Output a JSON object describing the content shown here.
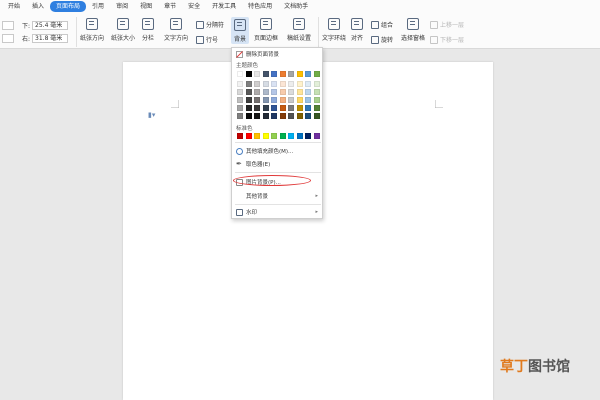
{
  "menu": {
    "tabs": [
      "开始",
      "插入",
      "页面布局",
      "引用",
      "审阅",
      "视图",
      "章节",
      "安全",
      "开发工具",
      "特色应用",
      "文档助手"
    ],
    "active_tab": "页面布局"
  },
  "ribbon": {
    "margins": {
      "top_value": "",
      "bottom_label": "下:",
      "bottom_value": "25.4 毫米",
      "left_value": "",
      "right_label": "右:",
      "right_value": "31.8 毫米"
    },
    "buttons": {
      "orientation": "纸张方向",
      "size": "纸张大小",
      "columns": "分栏",
      "text_direction": "文字方向",
      "breaks": "分隔符",
      "line_numbers": "行号",
      "background": "背景",
      "page_border": "页面边框",
      "paper_settings": "稿纸设置",
      "text_wrap": "文字环绕",
      "align": "对齐",
      "group": "组合",
      "rotate": "旋转",
      "selection_pane": "选择窗格",
      "move_up": "上移一层",
      "move_down": "下移一层"
    }
  },
  "dropdown": {
    "remove_bg": "删除页面背景",
    "theme_colors_label": "主题颜色",
    "standard_colors_label": "标准色",
    "more_fill": "其他填充颜色(M)...",
    "eyedropper": "取色器(E)",
    "picture_bg": "图片背景(P)...",
    "other_bg": "其他背景",
    "watermark": "水印",
    "theme_colors": [
      [
        "#ffffff",
        "#000000",
        "#e7e6e6",
        "#44546a",
        "#4472c4",
        "#ed7d31",
        "#a5a5a5",
        "#ffc000",
        "#5b9bd5",
        "#70ad47"
      ],
      [
        "#f2f2f2",
        "#7f7f7f",
        "#d0cece",
        "#d6dce4",
        "#d9e2f3",
        "#fbe5d5",
        "#ededed",
        "#fff2cc",
        "#deebf6",
        "#e2efd9"
      ],
      [
        "#d8d8d8",
        "#595959",
        "#aeabab",
        "#adb9ca",
        "#b4c6e7",
        "#f7cbac",
        "#dbdbdb",
        "#ffe599",
        "#bdd7ee",
        "#c5e0b3"
      ],
      [
        "#bfbfbf",
        "#3f3f3f",
        "#757070",
        "#8496b0",
        "#8eaadb",
        "#f4b183",
        "#c9c9c9",
        "#ffd965",
        "#9cc3e5",
        "#a8d08d"
      ],
      [
        "#a5a5a5",
        "#262626",
        "#3a3838",
        "#323f4f",
        "#2f5496",
        "#c55a11",
        "#7b7b7b",
        "#bf9000",
        "#2e75b5",
        "#538135"
      ],
      [
        "#7f7f7f",
        "#0c0c0c",
        "#171616",
        "#222a35",
        "#1f3864",
        "#833c0b",
        "#525252",
        "#7f6000",
        "#1e4e79",
        "#375623"
      ]
    ],
    "standard_colors": [
      "#c00000",
      "#ff0000",
      "#ffc000",
      "#ffff00",
      "#92d050",
      "#00b050",
      "#00b0f0",
      "#0070c0",
      "#002060",
      "#7030a0"
    ]
  },
  "watermark_brand": {
    "part1": "草丁",
    "part2": "图书馆"
  },
  "colors": {
    "active_tab": "#2f7fe0",
    "highlight_oval": "#e03a3a",
    "brand_orange": "#e07a1e"
  }
}
